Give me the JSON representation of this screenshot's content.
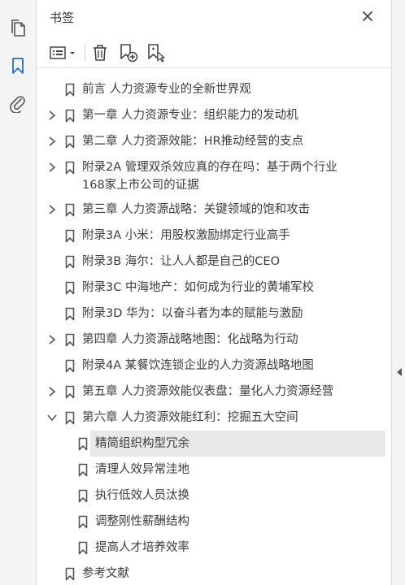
{
  "panel": {
    "title": "书签"
  },
  "rail": {
    "icons": [
      "pages-icon",
      "bookmark-icon",
      "attachment-icon"
    ]
  },
  "toolbar": {
    "buttons": [
      "options-menu-icon",
      "delete-bookmark-icon",
      "new-bookmark-icon",
      "bookmark-from-selection-icon"
    ]
  },
  "colors": {
    "accent": "#2a6cc7",
    "selected_bg": "#e8e8e8"
  },
  "bookmarks": [
    {
      "label": "前言 人力资源专业的全新世界观",
      "expandable": false,
      "expanded": false,
      "level": 0
    },
    {
      "label": "第一章 人力资源专业：组织能力的发动机",
      "expandable": true,
      "expanded": false,
      "level": 0
    },
    {
      "label": "第二章 人力资源效能：HR推动经营的支点",
      "expandable": true,
      "expanded": false,
      "level": 0
    },
    {
      "label": "附录2A 管理双杀效应真的存在吗：基于两个行业168家上市公司的证据",
      "expandable": true,
      "expanded": false,
      "level": 0
    },
    {
      "label": "第三章 人力资源战略：关键领域的饱和攻击",
      "expandable": true,
      "expanded": false,
      "level": 0
    },
    {
      "label": "附录3A 小米：用股权激励绑定行业高手",
      "expandable": false,
      "expanded": false,
      "level": 0
    },
    {
      "label": "附录3B 海尔：让人人都是自己的CEO",
      "expandable": false,
      "expanded": false,
      "level": 0
    },
    {
      "label": "附录3C 中海地产：如何成为行业的黄埔军校",
      "expandable": false,
      "expanded": false,
      "level": 0
    },
    {
      "label": "附录3D 华为：以奋斗者为本的赋能与激励",
      "expandable": false,
      "expanded": false,
      "level": 0
    },
    {
      "label": "第四章 人力资源战略地图：化战略为行动",
      "expandable": true,
      "expanded": false,
      "level": 0
    },
    {
      "label": "附录4A 某餐饮连锁企业的人力资源战略地图",
      "expandable": false,
      "expanded": false,
      "level": 0
    },
    {
      "label": "第五章 人力资源效能仪表盘：量化人力资源经营",
      "expandable": true,
      "expanded": false,
      "level": 0
    },
    {
      "label": "第六章 人力资源效能红利：挖掘五大空间",
      "expandable": true,
      "expanded": true,
      "level": 0
    },
    {
      "label": "精简组织构型冗余",
      "expandable": false,
      "expanded": false,
      "level": 1,
      "selected": true
    },
    {
      "label": "清理人效异常洼地",
      "expandable": false,
      "expanded": false,
      "level": 1
    },
    {
      "label": "执行低效人员汰换",
      "expandable": false,
      "expanded": false,
      "level": 1
    },
    {
      "label": "调整刚性薪酬结构",
      "expandable": false,
      "expanded": false,
      "level": 1
    },
    {
      "label": "提高人才培养效率",
      "expandable": false,
      "expanded": false,
      "level": 1
    },
    {
      "label": "参考文献",
      "expandable": false,
      "expanded": false,
      "level": 0
    }
  ]
}
